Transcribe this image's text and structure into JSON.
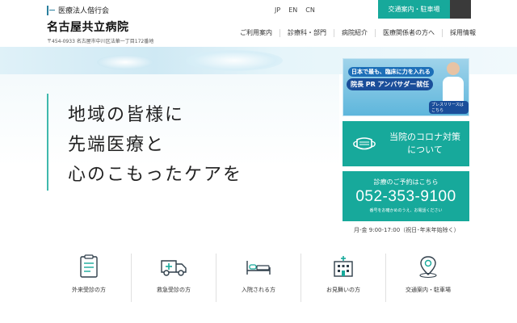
{
  "header": {
    "corp_name": "医療法人偕行会",
    "hospital_name": "名古屋共立病院",
    "address": "〒454-0933 名古屋市中川区法華一丁目172番地",
    "languages": [
      "JP",
      "EN",
      "CN"
    ],
    "access_button": "交通案内・駐車場"
  },
  "nav": {
    "items": [
      "ご利用案内",
      "診療科・部門",
      "病院紹介",
      "医療関係者の方へ",
      "採用情報"
    ]
  },
  "hero": {
    "line1": "地域の皆様に",
    "line2": "先端医療と",
    "line3": "心のこもったケアを"
  },
  "banners": {
    "pr_line1": "日本で最も、臨床に力を入れる",
    "pr_line2": "院長 PR アンバサダー就任",
    "pr_badge": "プレスリリースはこちら",
    "corona_line1": "当院のコロナ対策",
    "corona_line2": "について",
    "reserve_title": "診療のご予約はこちら",
    "reserve_phone": "052-353-9100",
    "reserve_note": "番号をお確かめのうえ、お電話ください",
    "hours": "月-金 9:00-17:00（祝日･年末年始除く）"
  },
  "quicknav": {
    "items": [
      {
        "label": "外来受診の方",
        "icon": "clipboard-icon"
      },
      {
        "label": "救急受診の方",
        "icon": "ambulance-icon"
      },
      {
        "label": "入院される方",
        "icon": "bed-icon"
      },
      {
        "label": "お見舞いの方",
        "icon": "hospital-icon"
      },
      {
        "label": "交通案内・駐車場",
        "icon": "map-pin-icon"
      }
    ]
  },
  "colors": {
    "accent": "#17a99b",
    "dark": "#3a3a3a"
  }
}
